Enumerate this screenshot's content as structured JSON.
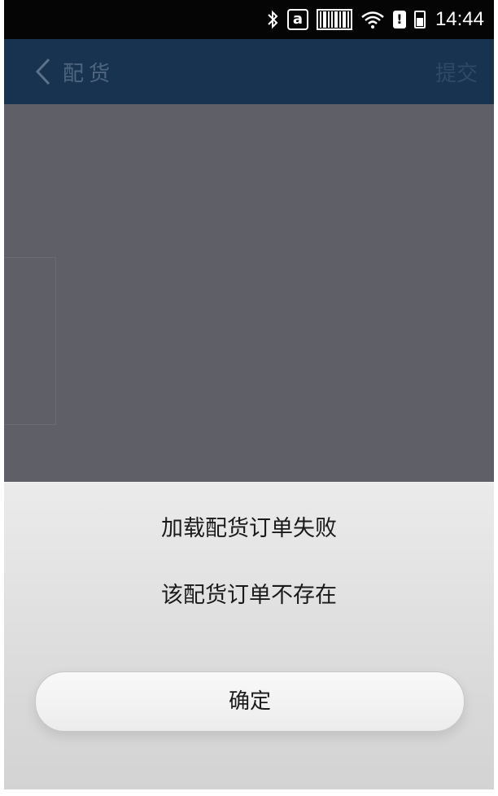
{
  "status_bar": {
    "a_icon": "a",
    "time": "14:44",
    "icons": [
      "bluetooth-icon",
      "a-notification-icon",
      "barcode-icon",
      "wifi-icon",
      "battery-warning-icon",
      "battery-icon"
    ]
  },
  "header": {
    "title": "配货",
    "submit_label": "提交",
    "background": "#18334f"
  },
  "dialog": {
    "title": "加载配货订单失败",
    "message": "该配货订单不存在",
    "confirm_label": "确定"
  },
  "colors": {
    "overlay": "#5e5f67",
    "statusbar": "#050506"
  }
}
